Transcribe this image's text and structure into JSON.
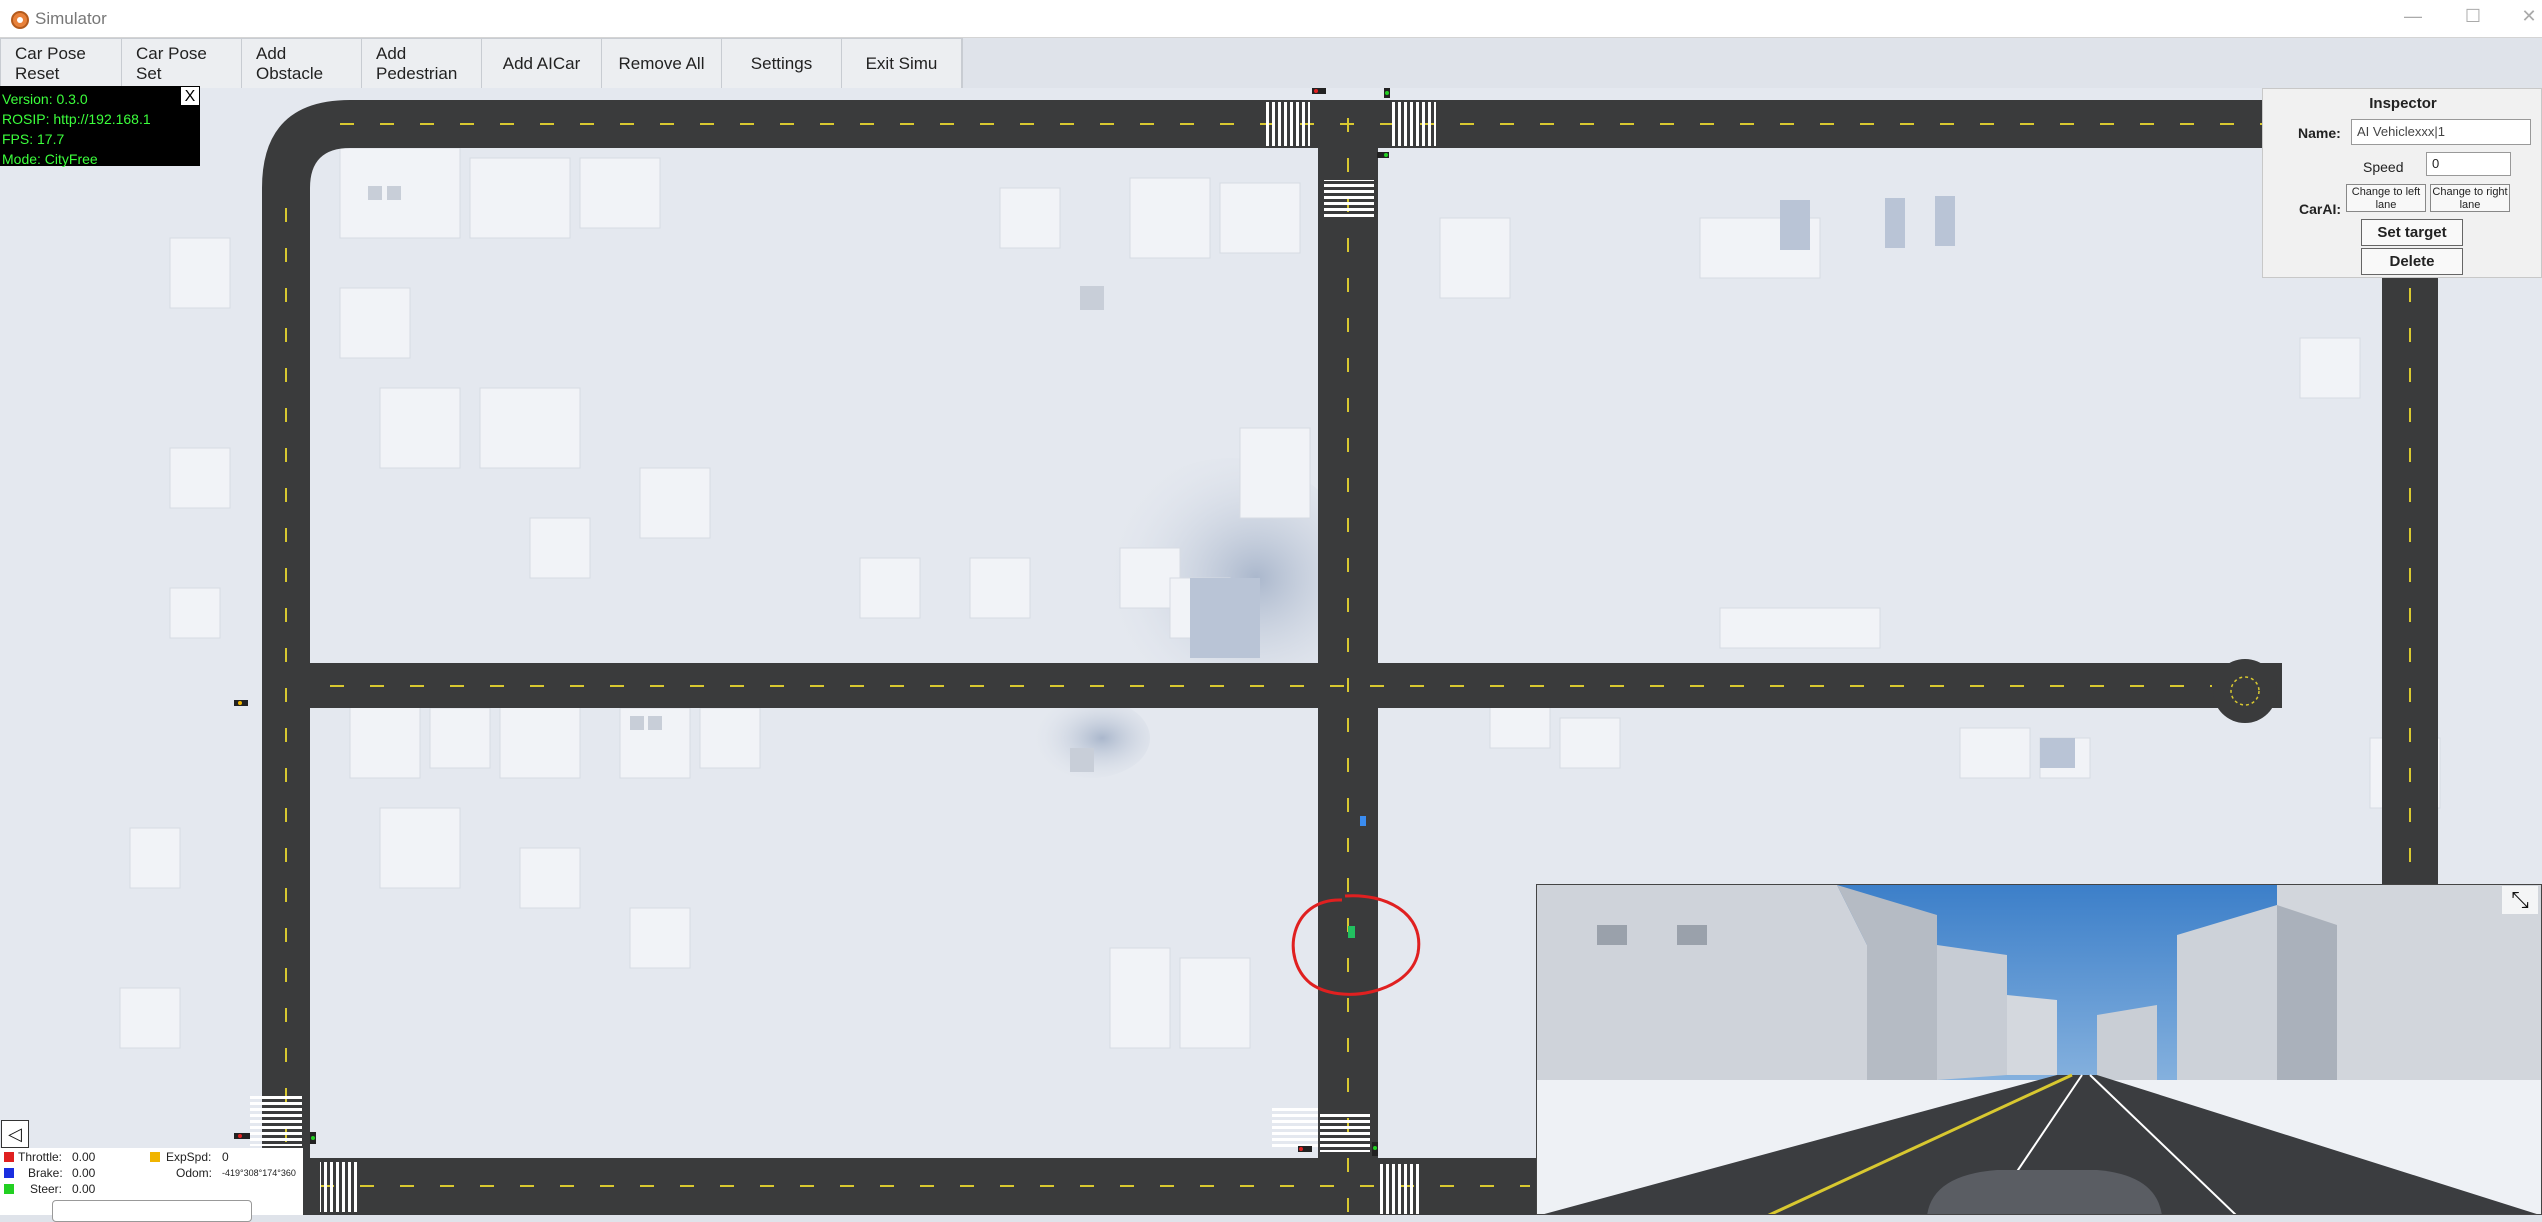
{
  "window": {
    "title": "Simulator",
    "minimize": "—",
    "maximize": "☐",
    "close": "✕"
  },
  "toolbar": {
    "buttons": [
      "Car Pose Reset",
      "Car Pose Set",
      "Add Obstacle",
      "Add Pedestrian",
      "Add AICar",
      "Remove All",
      "Settings",
      "Exit Simu"
    ]
  },
  "info": {
    "version": "Version:  0.3.0",
    "rosip": "ROSIP: http://192.168.1",
    "fps": "FPS:   17.7",
    "mode": "Mode: CityFree",
    "close": "X"
  },
  "inspector": {
    "title": "Inspector",
    "name_label": "Name:",
    "name_value": "AI Vehiclexxx|1",
    "speed_label": "Speed",
    "speed_value": "0",
    "carai_label": "CarAI:",
    "change_left": "Change to left lane",
    "change_right": "Change to right lane",
    "set_target": "Set target",
    "delete": "Delete"
  },
  "status": {
    "throttle_label": "Throttle:",
    "throttle_value": "0.00",
    "brake_label": "Brake:",
    "brake_value": "0.00",
    "steer_label": "Steer:",
    "steer_value": "0.00",
    "expspd_label": "ExpSpd:",
    "expspd_value": "0",
    "odom_label": "Odom:",
    "odom_value": "-419°308°174°360",
    "colors": {
      "throttle": "#e02020",
      "brake": "#1a2ee0",
      "steer": "#22d022",
      "expspd": "#f0b400"
    }
  },
  "icons": {
    "collapse": "◁",
    "expand": "⤡"
  },
  "colors": {
    "road": "#3a3b3c",
    "lane_yellow": "#d8c830",
    "info_text": "#3cff3c",
    "selection_circle": "#e02020"
  }
}
